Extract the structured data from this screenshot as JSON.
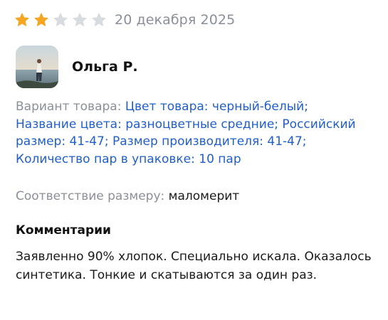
{
  "review": {
    "rating": {
      "value": 2,
      "max": 5,
      "filled_color": "#f5a623",
      "empty_color": "#d8dbe0"
    },
    "date": "20 декабря 2025",
    "author": {
      "name": "Ольга Р.",
      "avatar_icon": "user-photo-avatar"
    },
    "variant": {
      "label": "Вариант товара:",
      "value": "Цвет товара: черный-белый; Название цвета: разноцветные средние; Российский размер: 41-47; Размер производителя: 41-47; Количество пар в упаковке: 10 пар"
    },
    "size_fit": {
      "label": "Соответствие размеру:",
      "value": "маломерит"
    },
    "comments": {
      "heading": "Комментарии",
      "text": "Заявленно 90% хлопок. Специально искала. Оказалось синтетика. Тонкие и скатываются за один раз."
    }
  }
}
